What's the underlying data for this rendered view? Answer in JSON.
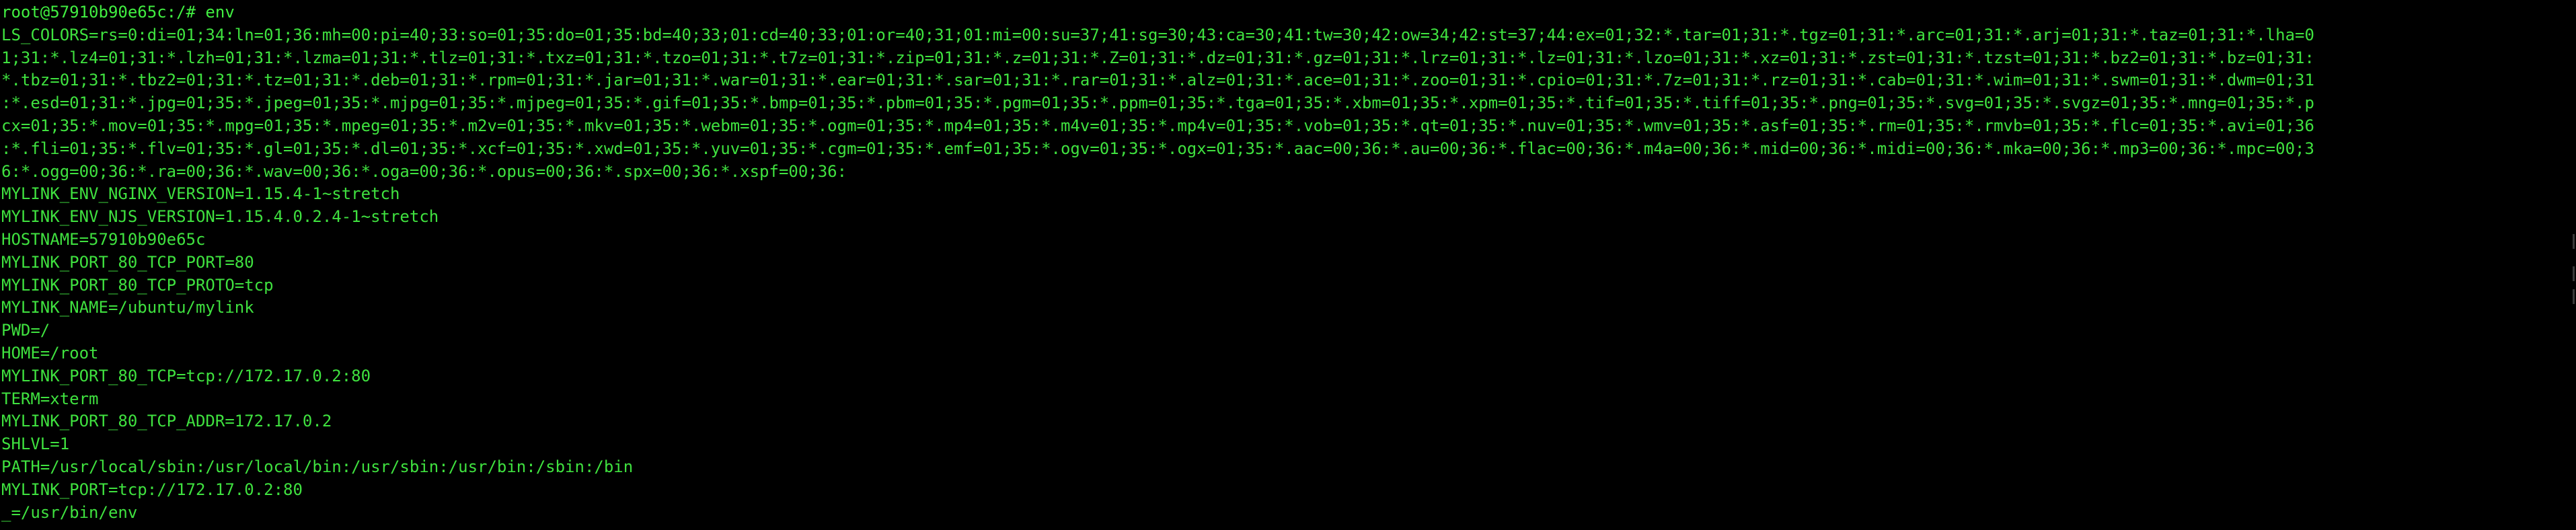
{
  "theme": {
    "background": "#000000",
    "foreground": "#3fe13f"
  },
  "terminal": {
    "prompt": "root@57910b90e65c:/# env",
    "ls_colors": [
      "LS_COLORS=rs=0:di=01;34:ln=01;36:mh=00:pi=40;33:so=01;35:do=01;35:bd=40;33;01:cd=40;33;01:or=40;31;01:mi=00:su=37;41:sg=30;43:ca=30;41:tw=30;42:ow=34;42:st=37;44:ex=01;32:*.tar=01;31:*.tgz=01;31:*.arc=01;31:*.arj=01;31:*.taz=01;31:*.lha=0",
      "1;31:*.lz4=01;31:*.lzh=01;31:*.lzma=01;31:*.tlz=01;31:*.txz=01;31:*.tzo=01;31:*.t7z=01;31:*.zip=01;31:*.z=01;31:*.Z=01;31:*.dz=01;31:*.gz=01;31:*.lrz=01;31:*.lz=01;31:*.lzo=01;31:*.xz=01;31:*.zst=01;31:*.tzst=01;31:*.bz2=01;31:*.bz=01;31:",
      "*.tbz=01;31:*.tbz2=01;31:*.tz=01;31:*.deb=01;31:*.rpm=01;31:*.jar=01;31:*.war=01;31:*.ear=01;31:*.sar=01;31:*.rar=01;31:*.alz=01;31:*.ace=01;31:*.zoo=01;31:*.cpio=01;31:*.7z=01;31:*.rz=01;31:*.cab=01;31:*.wim=01;31:*.swm=01;31:*.dwm=01;31",
      ":*.esd=01;31:*.jpg=01;35:*.jpeg=01;35:*.mjpg=01;35:*.mjpeg=01;35:*.gif=01;35:*.bmp=01;35:*.pbm=01;35:*.pgm=01;35:*.ppm=01;35:*.tga=01;35:*.xbm=01;35:*.xpm=01;35:*.tif=01;35:*.tiff=01;35:*.png=01;35:*.svg=01;35:*.svgz=01;35:*.mng=01;35:*.p",
      "cx=01;35:*.mov=01;35:*.mpg=01;35:*.mpeg=01;35:*.m2v=01;35:*.mkv=01;35:*.webm=01;35:*.ogm=01;35:*.mp4=01;35:*.m4v=01;35:*.mp4v=01;35:*.vob=01;35:*.qt=01;35:*.nuv=01;35:*.wmv=01;35:*.asf=01;35:*.rm=01;35:*.rmvb=01;35:*.flc=01;35:*.avi=01;36",
      ":*.fli=01;35:*.flv=01;35:*.gl=01;35:*.dl=01;35:*.xcf=01;35:*.xwd=01;35:*.yuv=01;35:*.cgm=01;35:*.emf=01;35:*.ogv=01;35:*.ogx=01;35:*.aac=00;36:*.au=00;36:*.flac=00;36:*.m4a=00;36:*.mid=00;36:*.midi=00;36:*.mka=00;36:*.mp3=00;36:*.mpc=00;3",
      "6:*.ogg=00;36:*.ra=00;36:*.wav=00;36:*.oga=00;36:*.opus=00;36:*.spx=00;36:*.xspf=00;36:"
    ],
    "env_lines": [
      "MYLINK_ENV_NGINX_VERSION=1.15.4-1~stretch",
      "MYLINK_ENV_NJS_VERSION=1.15.4.0.2.4-1~stretch",
      "HOSTNAME=57910b90e65c",
      "MYLINK_PORT_80_TCP_PORT=80",
      "MYLINK_PORT_80_TCP_PROTO=tcp",
      "MYLINK_NAME=/ubuntu/mylink",
      "PWD=/",
      "HOME=/root",
      "MYLINK_PORT_80_TCP=tcp://172.17.0.2:80",
      "TERM=xterm",
      "MYLINK_PORT_80_TCP_ADDR=172.17.0.2",
      "SHLVL=1",
      "PATH=/usr/local/sbin:/usr/local/bin:/usr/sbin:/usr/bin:/sbin:/bin",
      "MYLINK_PORT=tcp://172.17.0.2:80",
      "_=/usr/bin/env"
    ]
  }
}
